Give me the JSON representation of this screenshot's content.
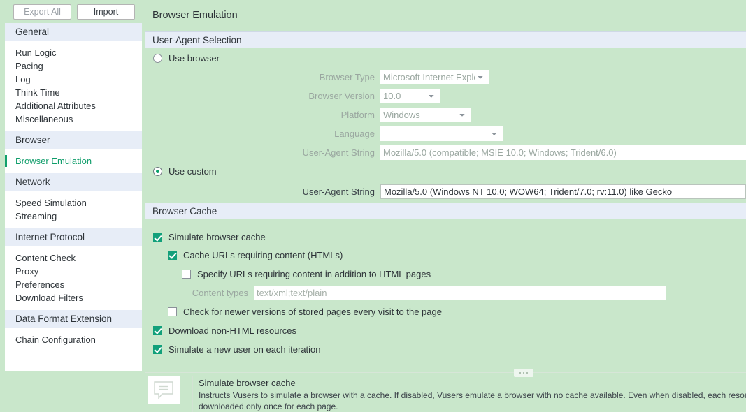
{
  "toolbar": {
    "export_all_label": "Export All",
    "import_label": "Import"
  },
  "sidebar": {
    "groups": [
      {
        "label": "General",
        "items": [
          {
            "label": "Run Logic",
            "active": false
          },
          {
            "label": "Pacing",
            "active": false
          },
          {
            "label": "Log",
            "active": false
          },
          {
            "label": "Think Time",
            "active": false
          },
          {
            "label": "Additional Attributes",
            "active": false
          },
          {
            "label": "Miscellaneous",
            "active": false
          }
        ]
      },
      {
        "label": "Browser",
        "items": [
          {
            "label": "Browser Emulation",
            "active": true
          }
        ]
      },
      {
        "label": "Network",
        "items": [
          {
            "label": "Speed Simulation",
            "active": false
          },
          {
            "label": "Streaming",
            "active": false
          }
        ]
      },
      {
        "label": "Internet Protocol",
        "items": [
          {
            "label": "Content Check",
            "active": false
          },
          {
            "label": "Proxy",
            "active": false
          },
          {
            "label": "Preferences",
            "active": false
          },
          {
            "label": "Download Filters",
            "active": false
          }
        ]
      },
      {
        "label": "Data Format Extension",
        "items": [
          {
            "label": "Chain Configuration",
            "active": false
          }
        ]
      }
    ]
  },
  "main": {
    "page_title": "Browser Emulation",
    "sections": {
      "user_agent": {
        "header": "User-Agent Selection",
        "use_browser_label": "Use browser",
        "use_browser_selected": false,
        "browser_type_label": "Browser Type",
        "browser_type_value": "Microsoft Internet Explorer",
        "browser_version_label": "Browser Version",
        "browser_version_value": "10.0",
        "platform_label": "Platform",
        "platform_value": "Windows",
        "language_label": "Language",
        "language_value": "",
        "browser_ua_label": "User-Agent String",
        "browser_ua_value": "Mozilla/5.0 (compatible; MSIE 10.0; Windows; Trident/6.0)",
        "use_custom_label": "Use custom",
        "use_custom_selected": true,
        "custom_ua_label": "User-Agent String",
        "custom_ua_value": "Mozilla/5.0 (Windows NT 10.0; WOW64; Trident/7.0; rv:11.0) like Gecko"
      },
      "browser_cache": {
        "header": "Browser Cache",
        "simulate_cache_label": "Simulate browser cache",
        "simulate_cache_checked": true,
        "cache_urls_label": "Cache URLs requiring content (HTMLs)",
        "cache_urls_checked": true,
        "specify_urls_label": "Specify URLs requiring content in addition to HTML pages",
        "specify_urls_checked": false,
        "content_types_label": "Content types",
        "content_types_value": "text/xml;text/plain",
        "check_newer_label": "Check for newer versions of stored pages every visit to the page",
        "check_newer_checked": false,
        "download_non_html_label": "Download non-HTML resources",
        "download_non_html_checked": true,
        "simulate_new_user_label": "Simulate a new user on each iteration",
        "simulate_new_user_checked": true
      }
    }
  },
  "help": {
    "title": "Simulate browser cache",
    "line1": "Instructs Vusers to simulate a browser with a cache. If disabled, Vusers emulate a browser with no cache available. Even when disabled, each resou",
    "line2": "downloaded only once for each page."
  },
  "colors": {
    "accent_green": "#12a07a",
    "active_item": "#0f9d6a",
    "section_header_bg": "#e7edf7",
    "page_bg": "#c9e7cb"
  }
}
